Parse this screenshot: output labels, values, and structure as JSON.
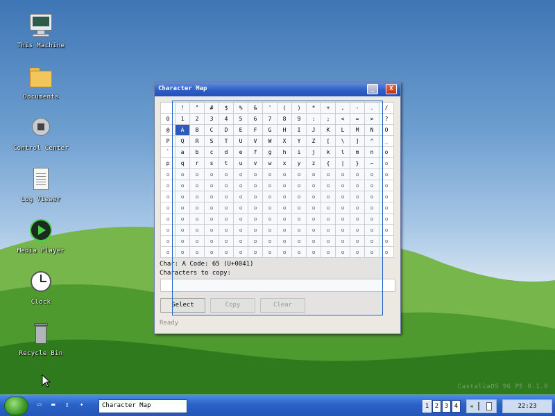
{
  "desktop": {
    "icons": [
      {
        "label": "This Machine",
        "icon": "computer-icon"
      },
      {
        "label": "Documents",
        "icon": "folder-icon"
      },
      {
        "label": "Control Center",
        "icon": "gear-icon"
      },
      {
        "label": "Log Viewer",
        "icon": "document-icon"
      },
      {
        "label": "Media Player",
        "icon": "media-play-icon"
      },
      {
        "label": "Clock",
        "icon": "clock-icon"
      },
      {
        "label": "Recycle Bin",
        "icon": "trash-icon"
      }
    ],
    "brand": "CastaliaOS 96 PE  0.1.0"
  },
  "window": {
    "title": "Character Map",
    "minimize_glyph": "_",
    "close_glyph": "X",
    "grid": [
      [
        " ",
        "!",
        "\"",
        "#",
        "$",
        "%",
        "&",
        "'",
        "(",
        ")",
        "*",
        "+",
        ",",
        "-",
        ".",
        "/"
      ],
      [
        "0",
        "1",
        "2",
        "3",
        "4",
        "5",
        "6",
        "7",
        "8",
        "9",
        ":",
        ";",
        "<",
        "=",
        ">",
        "?"
      ],
      [
        "@",
        "A",
        "B",
        "C",
        "D",
        "E",
        "F",
        "G",
        "H",
        "I",
        "J",
        "K",
        "L",
        "M",
        "N",
        "O"
      ],
      [
        "P",
        "Q",
        "R",
        "S",
        "T",
        "U",
        "V",
        "W",
        "X",
        "Y",
        "Z",
        "[",
        "\\",
        "]",
        "^",
        "_"
      ],
      [
        "`",
        "a",
        "b",
        "c",
        "d",
        "e",
        "f",
        "g",
        "h",
        "i",
        "j",
        "k",
        "l",
        "m",
        "n",
        "o"
      ],
      [
        "p",
        "q",
        "r",
        "s",
        "t",
        "u",
        "v",
        "w",
        "x",
        "y",
        "z",
        "{",
        "|",
        "}",
        "~",
        "▫"
      ],
      [
        "▫",
        "▫",
        "▫",
        "▫",
        "▫",
        "▫",
        "▫",
        "▫",
        "▫",
        "▫",
        "▫",
        "▫",
        "▫",
        "▫",
        "▫",
        "▫"
      ],
      [
        "▫",
        "▫",
        "▫",
        "▫",
        "▫",
        "▫",
        "▫",
        "▫",
        "▫",
        "▫",
        "▫",
        "▫",
        "▫",
        "▫",
        "▫",
        "▫"
      ],
      [
        "▫",
        "▫",
        "▫",
        "▫",
        "▫",
        "▫",
        "▫",
        "▫",
        "▫",
        "▫",
        "▫",
        "▫",
        "▫",
        "▫",
        "▫",
        "▫"
      ],
      [
        "▫",
        "▫",
        "▫",
        "▫",
        "▫",
        "▫",
        "▫",
        "▫",
        "▫",
        "▫",
        "▫",
        "▫",
        "▫",
        "▫",
        "▫",
        "▫"
      ],
      [
        "▫",
        "▫",
        "▫",
        "▫",
        "▫",
        "▫",
        "▫",
        "▫",
        "▫",
        "▫",
        "▫",
        "▫",
        "▫",
        "▫",
        "▫",
        "▫"
      ],
      [
        "▫",
        "▫",
        "▫",
        "▫",
        "▫",
        "▫",
        "▫",
        "▫",
        "▫",
        "▫",
        "▫",
        "▫",
        "▫",
        "▫",
        "▫",
        "▫"
      ],
      [
        "▫",
        "▫",
        "▫",
        "▫",
        "▫",
        "▫",
        "▫",
        "▫",
        "▫",
        "▫",
        "▫",
        "▫",
        "▫",
        "▫",
        "▫",
        "▫"
      ],
      [
        "▫",
        "▫",
        "▫",
        "▫",
        "▫",
        "▫",
        "▫",
        "▫",
        "▫",
        "▫",
        "▫",
        "▫",
        "▫",
        "▫",
        "▫",
        "▫"
      ]
    ],
    "selected_char": "A",
    "info_text": "Char: A   Code: 65 (U+0041)",
    "copy_label": "Characters to copy:",
    "copy_value": "",
    "buttons": {
      "select": "Select",
      "copy": "Copy",
      "clear": "Clear"
    },
    "status": "Ready"
  },
  "taskbar": {
    "quicklaunch": [
      "monitor-icon",
      "folder-icon",
      "document-icon",
      "gear-icon"
    ],
    "task_button": "Character Map",
    "workspaces": [
      "1",
      "2",
      "3",
      "4"
    ],
    "active_workspace": "1",
    "tray": [
      "speaker-icon",
      "network-icon",
      "battery-icon"
    ],
    "clock": "22:23"
  },
  "colors": {
    "titlebar": "#2d5fc5",
    "selection": "#2c5bbd",
    "desktop_sky": "#6e9fd0",
    "hills": "#3f8a25",
    "taskbar": "#2b62c7"
  }
}
